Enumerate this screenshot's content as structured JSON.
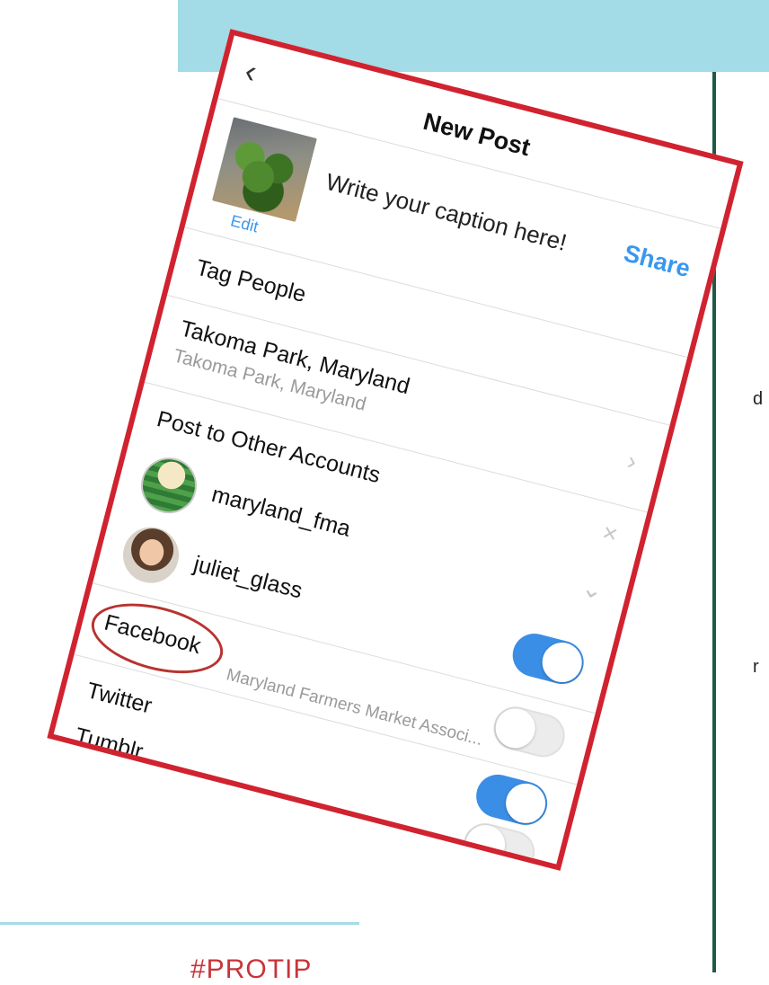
{
  "slide": {
    "edge_letters": [
      "d",
      "r"
    ],
    "footer_tag": "#PROTIP"
  },
  "screen": {
    "title": "New Post",
    "back_icon": "chevron-left-icon",
    "caption_placeholder": "Write your caption here!",
    "edit_label": "Edit",
    "share_label": "Share",
    "tag_people_label": "Tag People",
    "location": {
      "name": "Takoma Park, Maryland",
      "subtitle": "Takoma Park, Maryland"
    },
    "other_accounts_label": "Post to Other Accounts",
    "accounts": [
      {
        "name": "maryland_fma",
        "enabled": false
      },
      {
        "name": "juliet_glass",
        "enabled": true
      }
    ],
    "share_targets": [
      {
        "label": "Facebook",
        "subtitle": "Maryland Farmers Market Associ...",
        "enabled": false
      },
      {
        "label": "Twitter",
        "enabled": true
      },
      {
        "label": "Tumblr",
        "enabled": false
      }
    ],
    "colors": {
      "accent": "#3897f0",
      "toggle_on": "#3a8ee6",
      "frame": "#d0232f",
      "highlight": "#b8332f"
    }
  }
}
